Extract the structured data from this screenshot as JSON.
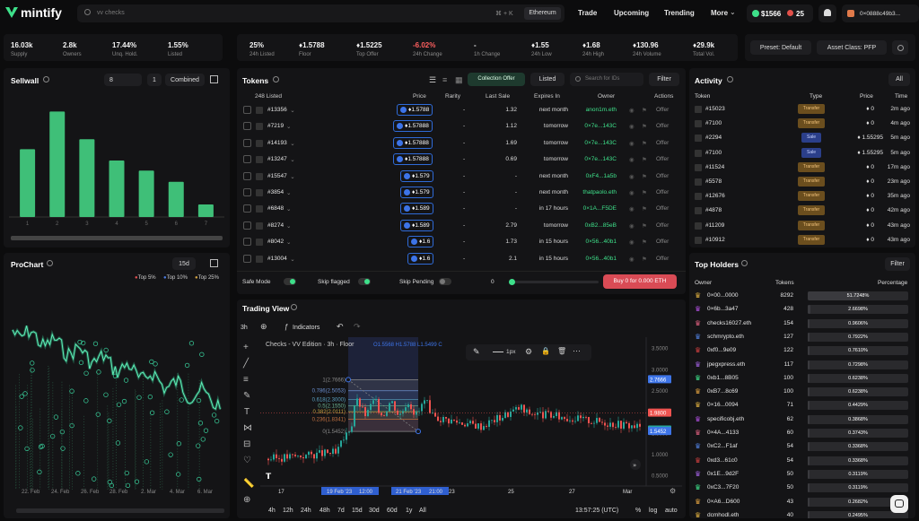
{
  "nav": {
    "brand": "mintify",
    "search_placeholder": "vv checks",
    "search_kbd": "⌘ + K",
    "chain": "Ethereum",
    "links": [
      "Trade",
      "Upcoming",
      "Trending",
      "More"
    ],
    "balance": "$1566",
    "points": "25",
    "account": "0×0888c49b3..."
  },
  "stats_left": [
    {
      "value": "16.03k",
      "label": "Supply"
    },
    {
      "value": "2.8k",
      "label": "Owners"
    },
    {
      "value": "17.44%",
      "label": "Unq. Hold."
    },
    {
      "value": "1.55%",
      "label": "Listed"
    }
  ],
  "stats_right": [
    {
      "value": "25%",
      "label": "24h Listed"
    },
    {
      "value": "♦1.5788",
      "label": "Floor"
    },
    {
      "value": "♦1.5225",
      "label": "Top Offer"
    },
    {
      "value": "-6.02%",
      "label": "24h Change"
    },
    {
      "value": "-",
      "label": "1h Change"
    },
    {
      "value": "♦1.55",
      "label": "24h Low"
    },
    {
      "value": "♦1.68",
      "label": "24h High"
    },
    {
      "value": "♦130.96",
      "label": "24h Volume"
    },
    {
      "value": "♦29.9k",
      "label": "Total Vol."
    }
  ],
  "presets": {
    "preset": "Preset: Default",
    "asset_class": "Asset Class: PFP"
  },
  "sellwall": {
    "title": "Sellwall",
    "input1": "8",
    "input2": "1",
    "mode": "Combined",
    "bars": [
      0.54,
      0.84,
      0.62,
      0.45,
      0.37,
      0.28,
      0.1
    ],
    "labels": [
      "1",
      "2",
      "3",
      "4",
      "5",
      "6",
      "7"
    ]
  },
  "prochart": {
    "title": "ProChart",
    "period": "15d",
    "legend": [
      "Top 5%",
      "Top 10%",
      "Top 25%"
    ],
    "xlabels": [
      "22. Feb",
      "24. Feb",
      "26. Feb",
      "28. Feb",
      "2. Mar",
      "4. Mar",
      "6. Mar"
    ]
  },
  "tokens": {
    "title": "Tokens",
    "collection_offer": "Collection Offer",
    "listed": "Listed",
    "search_placeholder": "Search for IDs",
    "filter": "Filter",
    "count": "248 Listed",
    "headers": [
      "Price",
      "Rarity",
      "Last Sale",
      "Expires In",
      "Owner",
      "Actions"
    ],
    "rows": [
      {
        "id": "#13356",
        "price": "1.5788",
        "rarity": "-",
        "last": "1.32",
        "exp": "next month",
        "owner": "anon1m.eth",
        "action": "Offer"
      },
      {
        "id": "#7219",
        "price": "1.57888",
        "rarity": "-",
        "last": "1.12",
        "exp": "tomorrow",
        "owner": "0×7e...143C",
        "action": "Offer"
      },
      {
        "id": "#14193",
        "price": "1.57888",
        "rarity": "-",
        "last": "1.69",
        "exp": "tomorrow",
        "owner": "0×7e...143C",
        "action": "Offer"
      },
      {
        "id": "#13247",
        "price": "1.57888",
        "rarity": "-",
        "last": "0.69",
        "exp": "tomorrow",
        "owner": "0×7e...143C",
        "action": "Offer"
      },
      {
        "id": "#15547",
        "price": "1.579",
        "rarity": "-",
        "last": "-",
        "exp": "next month",
        "owner": "0xF4...1a5b",
        "action": "Offer"
      },
      {
        "id": "#3854",
        "price": "1.579",
        "rarity": "-",
        "last": "-",
        "exp": "next month",
        "owner": "thatpaolo.eth",
        "action": "Offer"
      },
      {
        "id": "#6848",
        "price": "1.589",
        "rarity": "-",
        "last": "-",
        "exp": "in 17 hours",
        "owner": "0×1A...F5DE",
        "action": "Offer"
      },
      {
        "id": "#8274",
        "price": "1.589",
        "rarity": "-",
        "last": "2.79",
        "exp": "tomorrow",
        "owner": "0xB2...85eB",
        "action": "Offer"
      },
      {
        "id": "#8042",
        "price": "1.6",
        "rarity": "-",
        "last": "1.73",
        "exp": "in 15 hours",
        "owner": "0×56...40b1",
        "action": "Offer"
      },
      {
        "id": "#13004",
        "price": "1.6",
        "rarity": "-",
        "last": "2.1",
        "exp": "in 15 hours",
        "owner": "0×56...40b1",
        "action": "Offer"
      }
    ],
    "safe_mode": "Safe Mode",
    "skip_flagged": "Skip flagged",
    "skip_pending": "Skip Pending",
    "sweep_count": "0",
    "buy": "Buy 0 for 0.000 ETH"
  },
  "trading": {
    "title": "Trading View",
    "interval": "3h",
    "indicators": "Indicators",
    "chart_title": "Checks - VV Edition · 3h · Floor",
    "ohlc": "O1.5568 H1.5788 L1.5499 C",
    "stroke": "1px",
    "price_scale": [
      "3.5000",
      "3.0000",
      "2.5000",
      "2.0000",
      "1.5000",
      "1.0000",
      "0.5000"
    ],
    "price_tags": [
      "2.7666",
      "1.9800",
      "1.5788",
      "1.5452"
    ],
    "fib_levels": [
      "1(2.7666)",
      "0.786(2.5053)",
      "0.618(2.3000)",
      "0.5(2.1550)",
      "0.382(2.0111)",
      "0.236(1.8341)",
      "0(1.5452)"
    ],
    "time_labels": [
      "17",
      "19 Feb '23",
      "12:00",
      "21 Feb '23",
      "21:00",
      "23",
      "25",
      "27",
      "Mar"
    ],
    "ranges": [
      "4h",
      "12h",
      "24h",
      "48h",
      "7d",
      "15d",
      "30d",
      "60d",
      "1y",
      "All"
    ],
    "clock": "13:57:25 (UTC)",
    "opts": [
      "%",
      "log",
      "auto"
    ]
  },
  "activity": {
    "title": "Activity",
    "filter": "All",
    "headers": [
      "Token",
      "Type",
      "Price",
      "Time"
    ],
    "rows": [
      {
        "token": "#15023",
        "type": "Transfer",
        "price": "0",
        "time": "2m ago"
      },
      {
        "token": "#7100",
        "type": "Transfer",
        "price": "0",
        "time": "4m ago"
      },
      {
        "token": "#2294",
        "type": "Sale",
        "price": "1.55295",
        "time": "5m ago"
      },
      {
        "token": "#7100",
        "type": "Sale",
        "price": "1.55295",
        "time": "5m ago"
      },
      {
        "token": "#11524",
        "type": "Transfer",
        "price": "0",
        "time": "17m ago"
      },
      {
        "token": "#5578",
        "type": "Transfer",
        "price": "0",
        "time": "23m ago"
      },
      {
        "token": "#12676",
        "type": "Transfer",
        "price": "0",
        "time": "35m ago"
      },
      {
        "token": "#4878",
        "type": "Transfer",
        "price": "0",
        "time": "42m ago"
      },
      {
        "token": "#11209",
        "type": "Transfer",
        "price": "0",
        "time": "43m ago"
      },
      {
        "token": "#10912",
        "type": "Transfer",
        "price": "0",
        "time": "43m ago"
      }
    ]
  },
  "holders": {
    "title": "Top Holders",
    "filter": "Filter",
    "headers": [
      "Owner",
      "Tokens",
      "Percentage"
    ],
    "rows": [
      {
        "owner": "0×00...0000",
        "tokens": "8292",
        "pct": "51.7248%",
        "frac": 0.517
      },
      {
        "owner": "0×6b...3a47",
        "tokens": "428",
        "pct": "2.6698%",
        "frac": 0.027
      },
      {
        "owner": "checks16027.eth",
        "tokens": "154",
        "pct": "0.9606%",
        "frac": 0.01
      },
      {
        "owner": "schmrypto.eth",
        "tokens": "127",
        "pct": "0.7922%",
        "frac": 0.008
      },
      {
        "owner": "0xf0...9e09",
        "tokens": "122",
        "pct": "0.7610%",
        "frac": 0.008
      },
      {
        "owner": "jpegxpress.eth",
        "tokens": "117",
        "pct": "0.7298%",
        "frac": 0.007
      },
      {
        "owner": "0xb1...8B05",
        "tokens": "100",
        "pct": "0.6238%",
        "frac": 0.006
      },
      {
        "owner": "0xB7...8c69",
        "tokens": "100",
        "pct": "0.6238%",
        "frac": 0.006
      },
      {
        "owner": "0×16...0094",
        "tokens": "71",
        "pct": "0.4429%",
        "frac": 0.004
      },
      {
        "owner": "specificobj.eth",
        "tokens": "62",
        "pct": "0.3868%",
        "frac": 0.004
      },
      {
        "owner": "0×4A...4133",
        "tokens": "60",
        "pct": "0.3743%",
        "frac": 0.004
      },
      {
        "owner": "0xC2...F1af",
        "tokens": "54",
        "pct": "0.3368%",
        "frac": 0.003
      },
      {
        "owner": "0xd3...61c0",
        "tokens": "54",
        "pct": "0.3368%",
        "frac": 0.003
      },
      {
        "owner": "0x1E...9d2F",
        "tokens": "50",
        "pct": "0.3119%",
        "frac": 0.003
      },
      {
        "owner": "0xC3...7F20",
        "tokens": "50",
        "pct": "0.3119%",
        "frac": 0.003
      },
      {
        "owner": "0×A6...D600",
        "tokens": "43",
        "pct": "0.2682%",
        "frac": 0.003
      },
      {
        "owner": "dcmhodl.eth",
        "tokens": "40",
        "pct": "0.2495%",
        "frac": 0.002
      }
    ]
  },
  "colors": {
    "accent": "#3ee08a",
    "sale": "#2b3f8a",
    "transfer": "#6b4e1e",
    "buy": "#d94b55"
  }
}
